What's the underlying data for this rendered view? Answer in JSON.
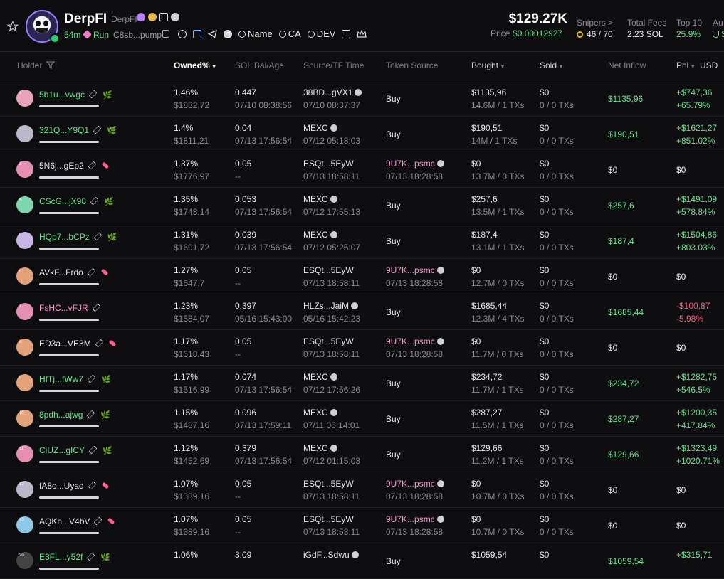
{
  "header": {
    "token_name": "DerpFI",
    "token_ticker": "DerpFI",
    "age": "54m",
    "run_label": "Run",
    "contract_short": "C8sb...pump",
    "links": {
      "name": "Name",
      "ca": "CA",
      "dev": "DEV"
    },
    "market_cap": "$129.27K",
    "price_label": "Price",
    "price_value": "$0.00012927",
    "snipers_label": "Snipers >",
    "snipers_value": "46 / 70",
    "fees_label": "Total Fees",
    "fees_value": "2.23 SOL",
    "top10_label": "Top 10",
    "top10_value": "25.9%",
    "audit_label": "Au",
    "audit_value": "S"
  },
  "columns": {
    "holder": "Holder",
    "owned": "Owned%",
    "sol_bal": "SOL Bal/Age",
    "source": "Source/TF Time",
    "token_source": "Token Source",
    "bought": "Bought",
    "sold": "Sold",
    "net_inflow": "Net Inflow",
    "pnl": "Pnl",
    "currency": "USD"
  },
  "colors": {
    "green": "#6ce08f",
    "red": "#ff5b7b",
    "pink": "#ff8fcf",
    "accent": "#9b7bff"
  },
  "rows": [
    {
      "num": "1",
      "addr": "5b1u...vwgc",
      "addr_color": "green",
      "tag": "leaf-icon",
      "owned": "1.46%",
      "owned_usd": "$1882,72",
      "sol": "0.447",
      "age": "07/10 08:38:56",
      "src": "38BD...gVX1",
      "src_coin": true,
      "src_time": "07/10 08:37:37",
      "tsrc": "Buy",
      "tsrc_pink": false,
      "tsrc_time": "",
      "bought": "$1135,96",
      "bought_sub": "14.6M / 1 TXs",
      "sold": "$0",
      "sold_sub": "0 / 0 TXs",
      "net": "$1135,96",
      "net_color": "green",
      "pnl1": "+$747,36",
      "pnl2": "+65.79%",
      "pnl_color": "green",
      "av": "#e7a3b8"
    },
    {
      "num": "2",
      "addr": "321Q...Y9Q1",
      "addr_color": "green",
      "tag": "leaf-icon",
      "owned": "1.4%",
      "owned_usd": "$1811,21",
      "sol": "0.04",
      "age": "07/13 17:56:54",
      "src": "MEXC",
      "src_coin": true,
      "src_time": "07/12 05:18:03",
      "tsrc": "Buy",
      "tsrc_pink": false,
      "tsrc_time": "",
      "bought": "$190,51",
      "bought_sub": "14M / 1 TXs",
      "sold": "$0",
      "sold_sub": "0 / 0 TXs",
      "net": "$190,51",
      "net_color": "green",
      "pnl1": "+$1621,27",
      "pnl2": "+851.02%",
      "pnl_color": "green",
      "av": "#b9b9c9"
    },
    {
      "num": "3",
      "addr": "5N6j...gEp2",
      "addr_color": "white",
      "tag": "pill-icon",
      "owned": "1.37%",
      "owned_usd": "$1776,97",
      "sol": "0.05",
      "age": "--",
      "src": "ESQt...5EyW",
      "src_coin": false,
      "src_time": "07/13 18:58:11",
      "tsrc": "9U7K...psmc",
      "tsrc_pink": true,
      "tsrc_time": "07/13 18:28:58",
      "bought": "$0",
      "bought_sub": "13.7M / 0 TXs",
      "sold": "$0",
      "sold_sub": "0 / 0 TXs",
      "net": "$0",
      "net_color": "white",
      "pnl1": "$0",
      "pnl2": "",
      "pnl_color": "white",
      "av": "#e58fb4"
    },
    {
      "num": "4",
      "addr": "CScG...jX98",
      "addr_color": "green",
      "tag": "leaf-icon",
      "owned": "1.35%",
      "owned_usd": "$1748,14",
      "sol": "0.053",
      "age": "07/13 17:56:54",
      "src": "MEXC",
      "src_coin": true,
      "src_time": "07/12 17:55:13",
      "tsrc": "Buy",
      "tsrc_pink": false,
      "tsrc_time": "",
      "bought": "$257,6",
      "bought_sub": "13.5M / 1 TXs",
      "sold": "$0",
      "sold_sub": "0 / 0 TXs",
      "net": "$257,6",
      "net_color": "green",
      "pnl1": "+$1491,09",
      "pnl2": "+578.84%",
      "pnl_color": "green",
      "av": "#7fd6b0"
    },
    {
      "num": "5",
      "addr": "HQp7...bCPz",
      "addr_color": "green",
      "tag": "leaf-icon",
      "owned": "1.31%",
      "owned_usd": "$1691,72",
      "sol": "0.039",
      "age": "07/13 17:56:54",
      "src": "MEXC",
      "src_coin": true,
      "src_time": "07/12 05:25:07",
      "tsrc": "Buy",
      "tsrc_pink": false,
      "tsrc_time": "",
      "bought": "$187,4",
      "bought_sub": "13.1M / 1 TXs",
      "sold": "$0",
      "sold_sub": "0 / 0 TXs",
      "net": "$187,4",
      "net_color": "green",
      "pnl1": "+$1504,86",
      "pnl2": "+803.03%",
      "pnl_color": "green",
      "av": "#c7b6e6"
    },
    {
      "num": "6",
      "addr": "AVkF...Frdo",
      "addr_color": "white",
      "tag": "pill-icon",
      "owned": "1.27%",
      "owned_usd": "$1647,7",
      "sol": "0.05",
      "age": "--",
      "src": "ESQt...5EyW",
      "src_coin": false,
      "src_time": "07/13 18:58:11",
      "tsrc": "9U7K...psmc",
      "tsrc_pink": true,
      "tsrc_time": "07/13 18:28:58",
      "bought": "$0",
      "bought_sub": "12.7M / 0 TXs",
      "sold": "$0",
      "sold_sub": "0 / 0 TXs",
      "net": "$0",
      "net_color": "white",
      "pnl1": "$0",
      "pnl2": "",
      "pnl_color": "white",
      "av": "#e3a27a"
    },
    {
      "num": "7",
      "addr": "FsHC...vFJR",
      "addr_color": "pink",
      "tag": "",
      "owned": "1.23%",
      "owned_usd": "$1584,07",
      "sol": "0.397",
      "age": "05/16 15:43:00",
      "src": "HLZs...JaiM",
      "src_coin": true,
      "src_time": "05/16 15:42:23",
      "tsrc": "Buy",
      "tsrc_pink": false,
      "tsrc_time": "",
      "bought": "$1685,44",
      "bought_sub": "12.3M / 4 TXs",
      "sold": "$0",
      "sold_sub": "0 / 0 TXs",
      "net": "$1685,44",
      "net_color": "green",
      "pnl1": "-$100,87",
      "pnl2": "-5.98%",
      "pnl_color": "red",
      "av": "#e58fb4"
    },
    {
      "num": "8",
      "addr": "ED3a...VE3M",
      "addr_color": "white",
      "tag": "pill-icon",
      "owned": "1.17%",
      "owned_usd": "$1518,43",
      "sol": "0.05",
      "age": "--",
      "src": "ESQt...5EyW",
      "src_coin": false,
      "src_time": "07/13 18:58:11",
      "tsrc": "9U7K...psmc",
      "tsrc_pink": true,
      "tsrc_time": "07/13 18:28:58",
      "bought": "$0",
      "bought_sub": "11.7M / 0 TXs",
      "sold": "$0",
      "sold_sub": "0 / 0 TXs",
      "net": "$0",
      "net_color": "white",
      "pnl1": "$0",
      "pnl2": "",
      "pnl_color": "white",
      "av": "#e3a27a"
    },
    {
      "num": "9",
      "addr": "HfTj...fWw7",
      "addr_color": "green",
      "tag": "leaf-icon",
      "owned": "1.17%",
      "owned_usd": "$1516,99",
      "sol": "0.074",
      "age": "07/13 17:56:54",
      "src": "MEXC",
      "src_coin": true,
      "src_time": "07/12 17:56:26",
      "tsrc": "Buy",
      "tsrc_pink": false,
      "tsrc_time": "",
      "bought": "$234,72",
      "bought_sub": "11.7M / 1 TXs",
      "sold": "$0",
      "sold_sub": "0 / 0 TXs",
      "net": "$234,72",
      "net_color": "green",
      "pnl1": "+$1282,75",
      "pnl2": "+546.5%",
      "pnl_color": "green",
      "av": "#e3a27a"
    },
    {
      "num": "10",
      "addr": "8pdh...ajwg",
      "addr_color": "green",
      "tag": "leaf-icon",
      "owned": "1.15%",
      "owned_usd": "$1487,16",
      "sol": "0.096",
      "age": "07/13 17:59:11",
      "src": "MEXC",
      "src_coin": true,
      "src_time": "07/11 06:14:01",
      "tsrc": "Buy",
      "tsrc_pink": false,
      "tsrc_time": "",
      "bought": "$287,27",
      "bought_sub": "11.5M / 1 TXs",
      "sold": "$0",
      "sold_sub": "0 / 0 TXs",
      "net": "$287,27",
      "net_color": "green",
      "pnl1": "+$1200,35",
      "pnl2": "+417.84%",
      "pnl_color": "green",
      "av": "#e3a27a"
    },
    {
      "num": "11",
      "addr": "CiUZ...gICY",
      "addr_color": "green",
      "tag": "leaf-icon",
      "owned": "1.12%",
      "owned_usd": "$1452,69",
      "sol": "0.379",
      "age": "07/13 17:56:54",
      "src": "MEXC",
      "src_coin": true,
      "src_time": "07/12 01:15:03",
      "tsrc": "Buy",
      "tsrc_pink": false,
      "tsrc_time": "",
      "bought": "$129,66",
      "bought_sub": "11.2M / 1 TXs",
      "sold": "$0",
      "sold_sub": "0 / 0 TXs",
      "net": "$129,66",
      "net_color": "green",
      "pnl1": "+$1323,49",
      "pnl2": "+1020.71%",
      "pnl_color": "green",
      "av": "#e58fb4"
    },
    {
      "num": "12",
      "addr": "fA8o...Uyad",
      "addr_color": "white",
      "tag": "pill-icon",
      "owned": "1.07%",
      "owned_usd": "$1389,16",
      "sol": "0.05",
      "age": "--",
      "src": "ESQt...5EyW",
      "src_coin": false,
      "src_time": "07/13 18:58:11",
      "tsrc": "9U7K...psmc",
      "tsrc_pink": true,
      "tsrc_time": "07/13 18:28:58",
      "bought": "$0",
      "bought_sub": "10.7M / 0 TXs",
      "sold": "$0",
      "sold_sub": "0 / 0 TXs",
      "net": "$0",
      "net_color": "white",
      "pnl1": "$0",
      "pnl2": "",
      "pnl_color": "white",
      "av": "#b9b9c9"
    },
    {
      "num": "13",
      "addr": "AQKn...V4bV",
      "addr_color": "white",
      "tag": "pill-icon",
      "owned": "1.07%",
      "owned_usd": "$1389,16",
      "sol": "0.05",
      "age": "--",
      "src": "ESQt...5EyW",
      "src_coin": false,
      "src_time": "07/13 18:58:11",
      "tsrc": "9U7K...psmc",
      "tsrc_pink": true,
      "tsrc_time": "07/13 18:28:58",
      "bought": "$0",
      "bought_sub": "10.7M / 0 TXs",
      "sold": "$0",
      "sold_sub": "0 / 0 TXs",
      "net": "$0",
      "net_color": "white",
      "pnl1": "$0",
      "pnl2": "",
      "pnl_color": "white",
      "av": "#8fc7e6"
    },
    {
      "num": "20",
      "addr": "E3FL...y52f",
      "addr_color": "green",
      "tag": "leaf-icon",
      "owned": "1.06%",
      "owned_usd": "",
      "sol": "3.09",
      "age": "",
      "src": "iGdF...Sdwu",
      "src_coin": true,
      "src_time": "",
      "tsrc": "Buy",
      "tsrc_pink": false,
      "tsrc_time": "",
      "bought": "$1059,54",
      "bought_sub": "",
      "sold": "$0",
      "sold_sub": "",
      "net": "$1059,54",
      "net_color": "green",
      "pnl1": "+$315,71",
      "pnl2": "",
      "pnl_color": "green",
      "av": "#444"
    }
  ]
}
